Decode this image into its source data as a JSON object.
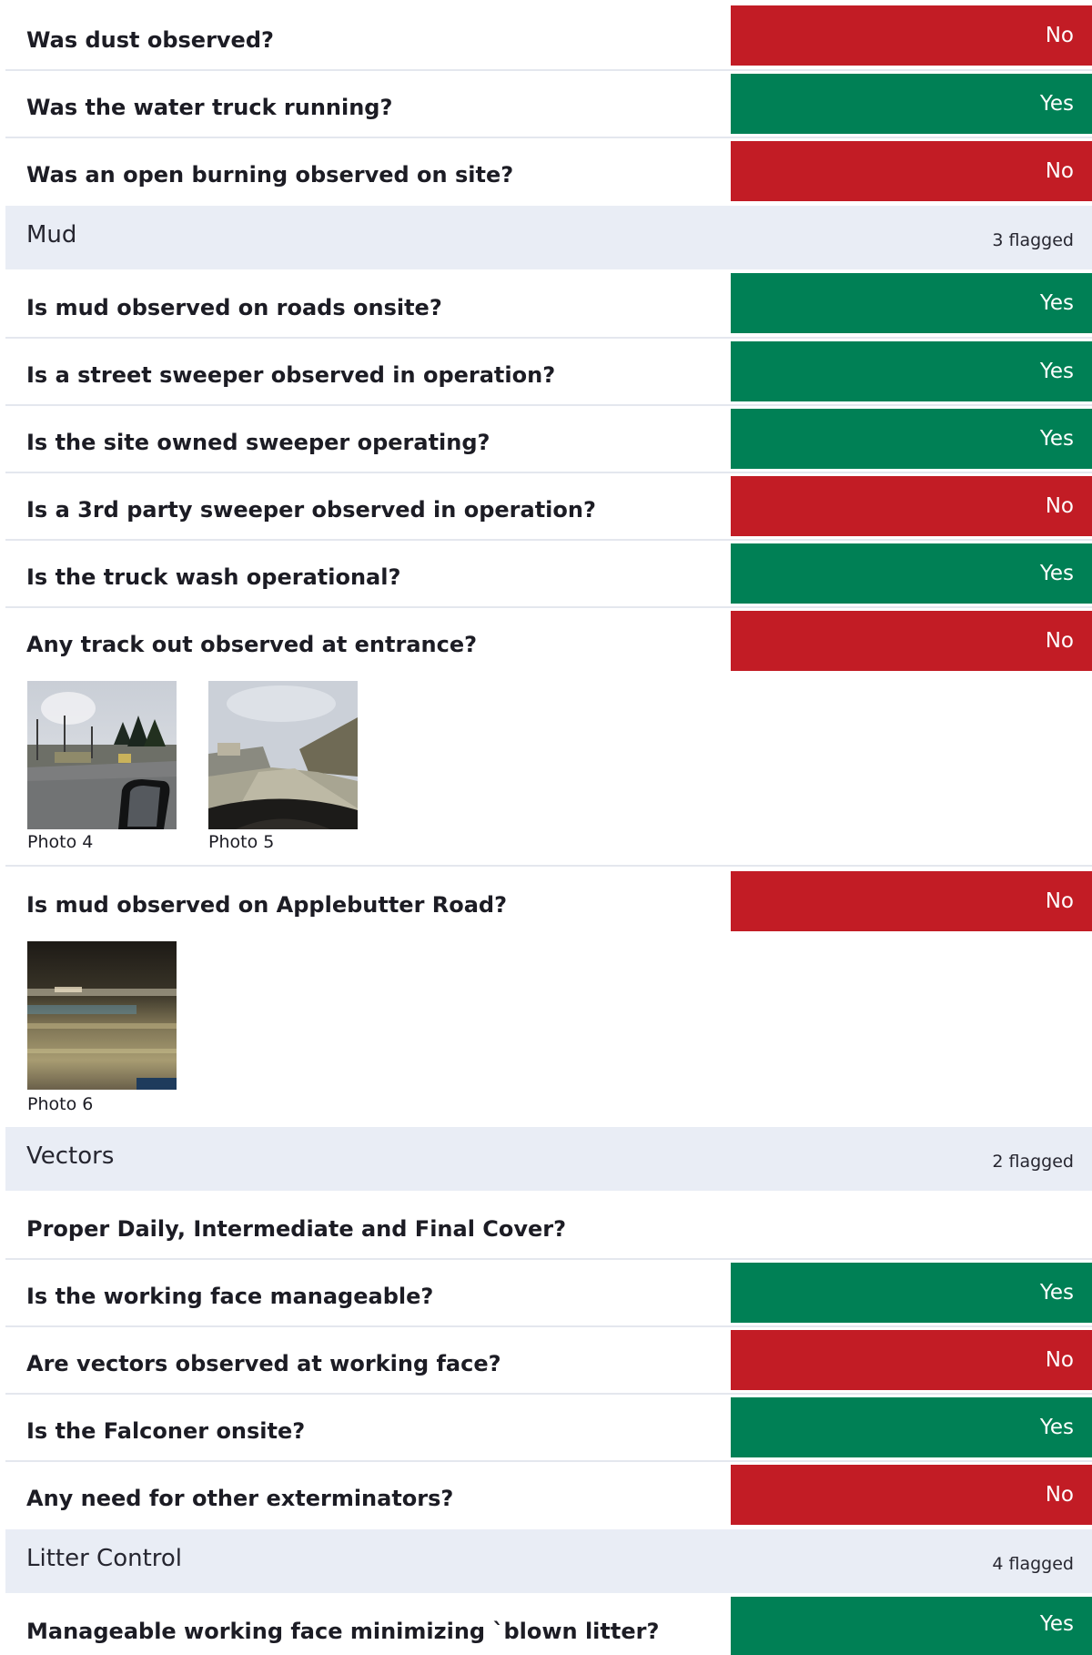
{
  "colors": {
    "yes": "#008055",
    "no": "#c21c25",
    "section_bg": "#e9edf5",
    "divider": "#e4e7ee"
  },
  "dust": {
    "q1": {
      "question": "Was dust observed?",
      "answer": "No"
    },
    "q2": {
      "question": "Was the water truck running?",
      "answer": "Yes"
    },
    "q3": {
      "question": "Was an open burning observed on site?",
      "answer": "No"
    }
  },
  "mud": {
    "title": "Mud",
    "flagged": "3 flagged",
    "q1": {
      "question": "Is mud observed  on roads onsite?",
      "answer": "Yes"
    },
    "q2": {
      "question": "Is a street sweeper observed in operation?",
      "answer": "Yes"
    },
    "q3": {
      "question": "Is the site owned sweeper operating?",
      "answer": "Yes"
    },
    "q4": {
      "question": "Is a 3rd party sweeper observed in operation?",
      "answer": "No"
    },
    "q5": {
      "question": "Is the truck wash operational?",
      "answer": "Yes"
    },
    "q6": {
      "question": "Any track out observed at entrance?",
      "answer": "No",
      "photos": [
        "Photo 4",
        "Photo 5"
      ]
    },
    "q7": {
      "question": "Is mud observed on Applebutter Road?",
      "answer": "No",
      "photos": [
        "Photo 6"
      ]
    }
  },
  "vectors": {
    "title": "Vectors",
    "flagged": "2 flagged",
    "q1": {
      "question": "Proper Daily, Intermediate and Final Cover?"
    },
    "q2": {
      "question": "Is the working face manageable?",
      "answer": "Yes"
    },
    "q3": {
      "question": "Are vectors observed at working face?",
      "answer": "No"
    },
    "q4": {
      "question": "Is the Falconer onsite?",
      "answer": "Yes"
    },
    "q5": {
      "question": "Any need for other exterminators?",
      "answer": "No"
    }
  },
  "litter": {
    "title": "Litter Control",
    "flagged": "4 flagged",
    "q1": {
      "question": "Manageable working face minimizing `blown litter?",
      "answer": "Yes"
    }
  }
}
